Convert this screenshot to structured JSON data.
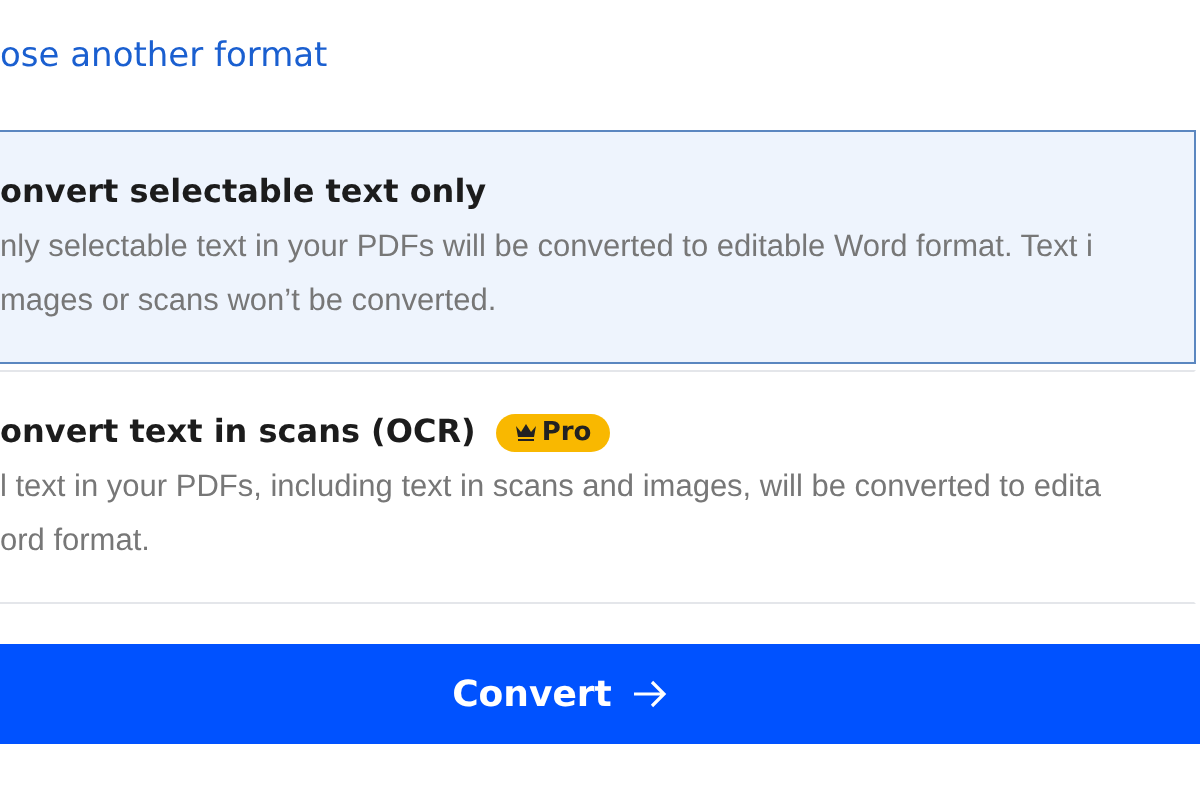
{
  "link": "ose another format",
  "options": [
    {
      "title": "onvert selectable text only",
      "selected": true,
      "description": [
        "nly selectable text in your PDFs will be converted to editable Word format. Text i",
        "mages or scans won’t be converted."
      ]
    },
    {
      "title": "onvert text in scans (OCR)",
      "selected": false,
      "badge": "Pro",
      "description": [
        "l text in your PDFs, including text in scans and images, will be converted to edita",
        "ord format."
      ]
    }
  ],
  "button": "Convert"
}
